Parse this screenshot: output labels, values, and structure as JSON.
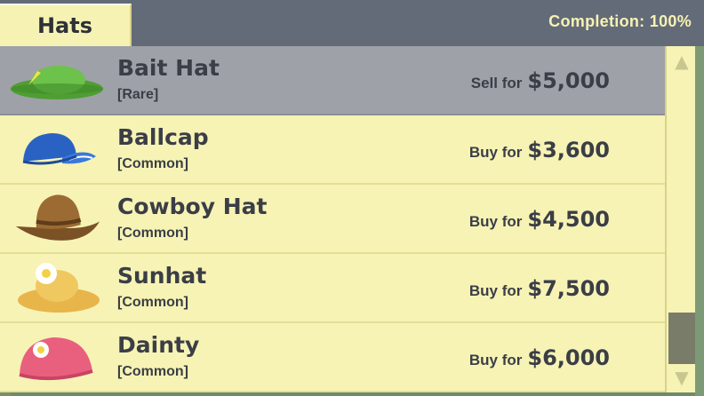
{
  "header": {
    "tab_label": "Hats",
    "completion": "Completion: 100%"
  },
  "items": [
    {
      "name": "Bait Hat",
      "rarity": "[Rare]",
      "action": "Sell for",
      "price": "$5,000",
      "icon": "green-hat-icon",
      "selected": true
    },
    {
      "name": "Ballcap",
      "rarity": "[Common]",
      "action": "Buy for",
      "price": "$3,600",
      "icon": "ballcap-icon",
      "selected": false
    },
    {
      "name": "Cowboy Hat",
      "rarity": "[Common]",
      "action": "Buy for",
      "price": "$4,500",
      "icon": "cowboy-hat-icon",
      "selected": false
    },
    {
      "name": "Sunhat",
      "rarity": "[Common]",
      "action": "Buy for",
      "price": "$7,500",
      "icon": "sunhat-icon",
      "selected": false
    },
    {
      "name": "Dainty",
      "rarity": "[Common]",
      "action": "Buy for",
      "price": "$6,000",
      "icon": "dainty-hat-icon",
      "selected": false
    }
  ],
  "scrollbar": {
    "up_icon": "up-arrow-icon",
    "down_icon": "down-arrow-icon"
  }
}
